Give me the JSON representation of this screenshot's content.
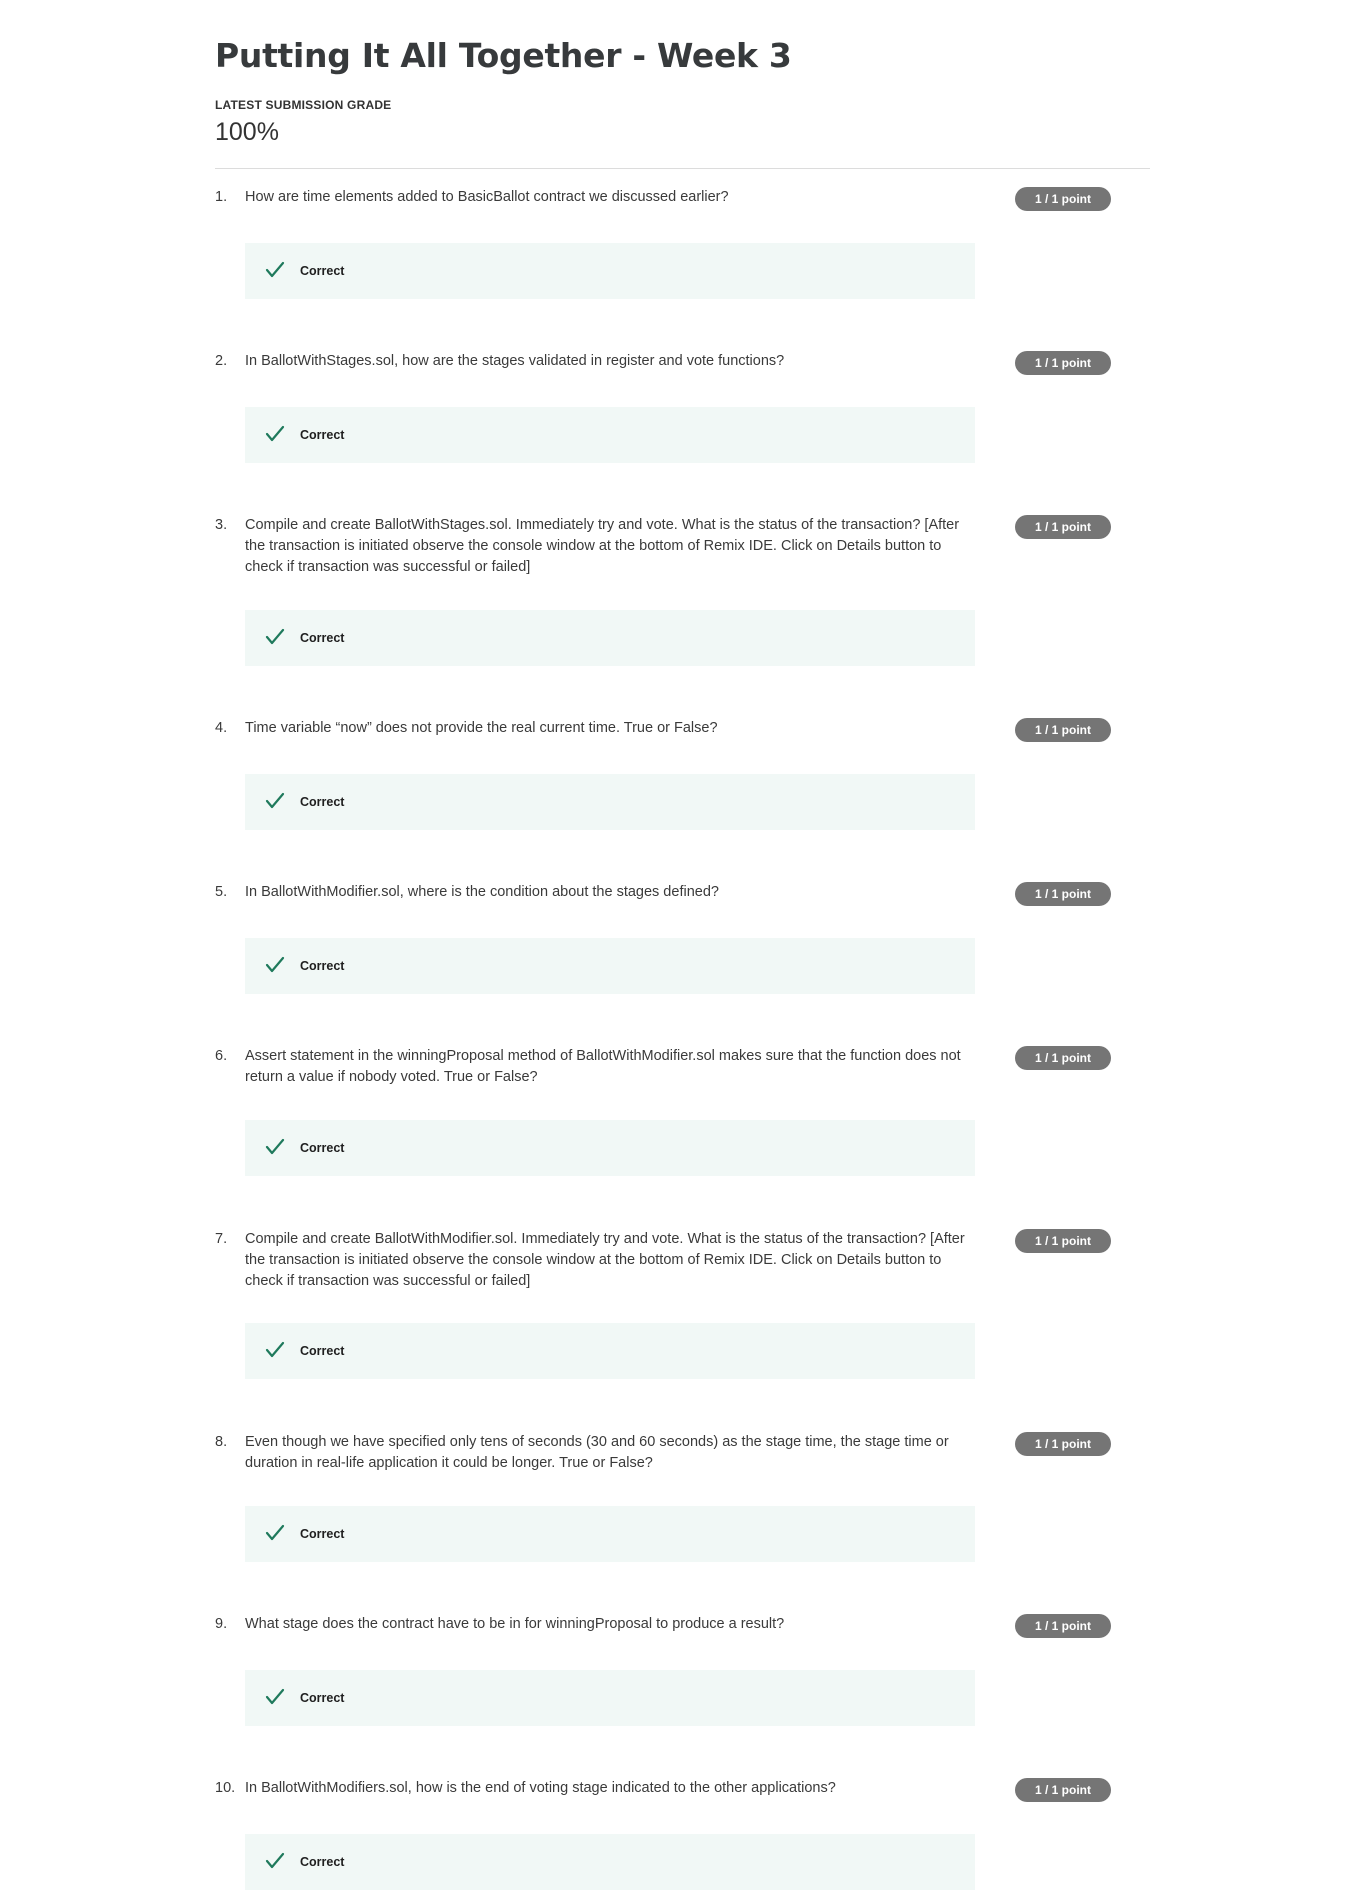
{
  "page": {
    "title": "Putting It All Together - Week 3",
    "grade_label": "LATEST SUBMISSION GRADE",
    "grade_value": "100%"
  },
  "colors": {
    "badge": "#757575",
    "feedback_bg": "#f1f8f6",
    "check": "#1f7a5c"
  },
  "icons": {
    "feedback": "check-icon"
  },
  "questions": [
    {
      "num": "1.",
      "text": "How are time elements added to BasicBallot contract we discussed earlier?",
      "points": "1 / 1 point",
      "feedback": "Correct"
    },
    {
      "num": "2.",
      "text": "In BallotWithStages.sol, how are the stages validated in register and vote functions?",
      "points": "1 / 1 point",
      "feedback": "Correct"
    },
    {
      "num": "3.",
      "text": "Compile and create BallotWithStages.sol. Immediately try and vote. What is the status of the transaction? [After the transaction is initiated observe the console window at the bottom of Remix IDE. Click on Details button to check if transaction was successful or failed]",
      "points": "1 / 1 point",
      "feedback": "Correct"
    },
    {
      "num": "4.",
      "text": "Time variable “now” does not provide the real current time. True or False?",
      "points": "1 / 1 point",
      "feedback": "Correct"
    },
    {
      "num": "5.",
      "text": "In BallotWithModifier.sol, where is the condition about the stages defined?",
      "points": "1 / 1 point",
      "feedback": "Correct"
    },
    {
      "num": "6.",
      "text": "Assert statement in the winningProposal method of BallotWithModifier.sol makes sure that the function does not return a value if nobody voted. True or False?",
      "points": "1 / 1 point",
      "feedback": "Correct"
    },
    {
      "num": "7.",
      "text": "Compile and create BallotWithModifier.sol. Immediately try and vote. What is the status of the transaction? [After the transaction is initiated observe the console window at the bottom of Remix IDE. Click on Details button to check if transaction was successful or failed]",
      "points": "1 / 1 point",
      "feedback": "Correct"
    },
    {
      "num": "8.",
      "text": "Even though we have specified only tens of seconds (30 and 60 seconds) as the stage time, the stage time or duration in real-life application it could be longer. True or False?",
      "points": "1 / 1 point",
      "feedback": "Correct"
    },
    {
      "num": "9.",
      "text": "What stage does the contract have to be in for winningProposal to produce a result?",
      "points": "1 / 1 point",
      "feedback": "Correct"
    },
    {
      "num": "10.",
      "text": "In BallotWithModifiers.sol, how is the end of voting stage indicated to the other applications?",
      "points": "1 / 1 point",
      "feedback": "Correct"
    }
  ]
}
